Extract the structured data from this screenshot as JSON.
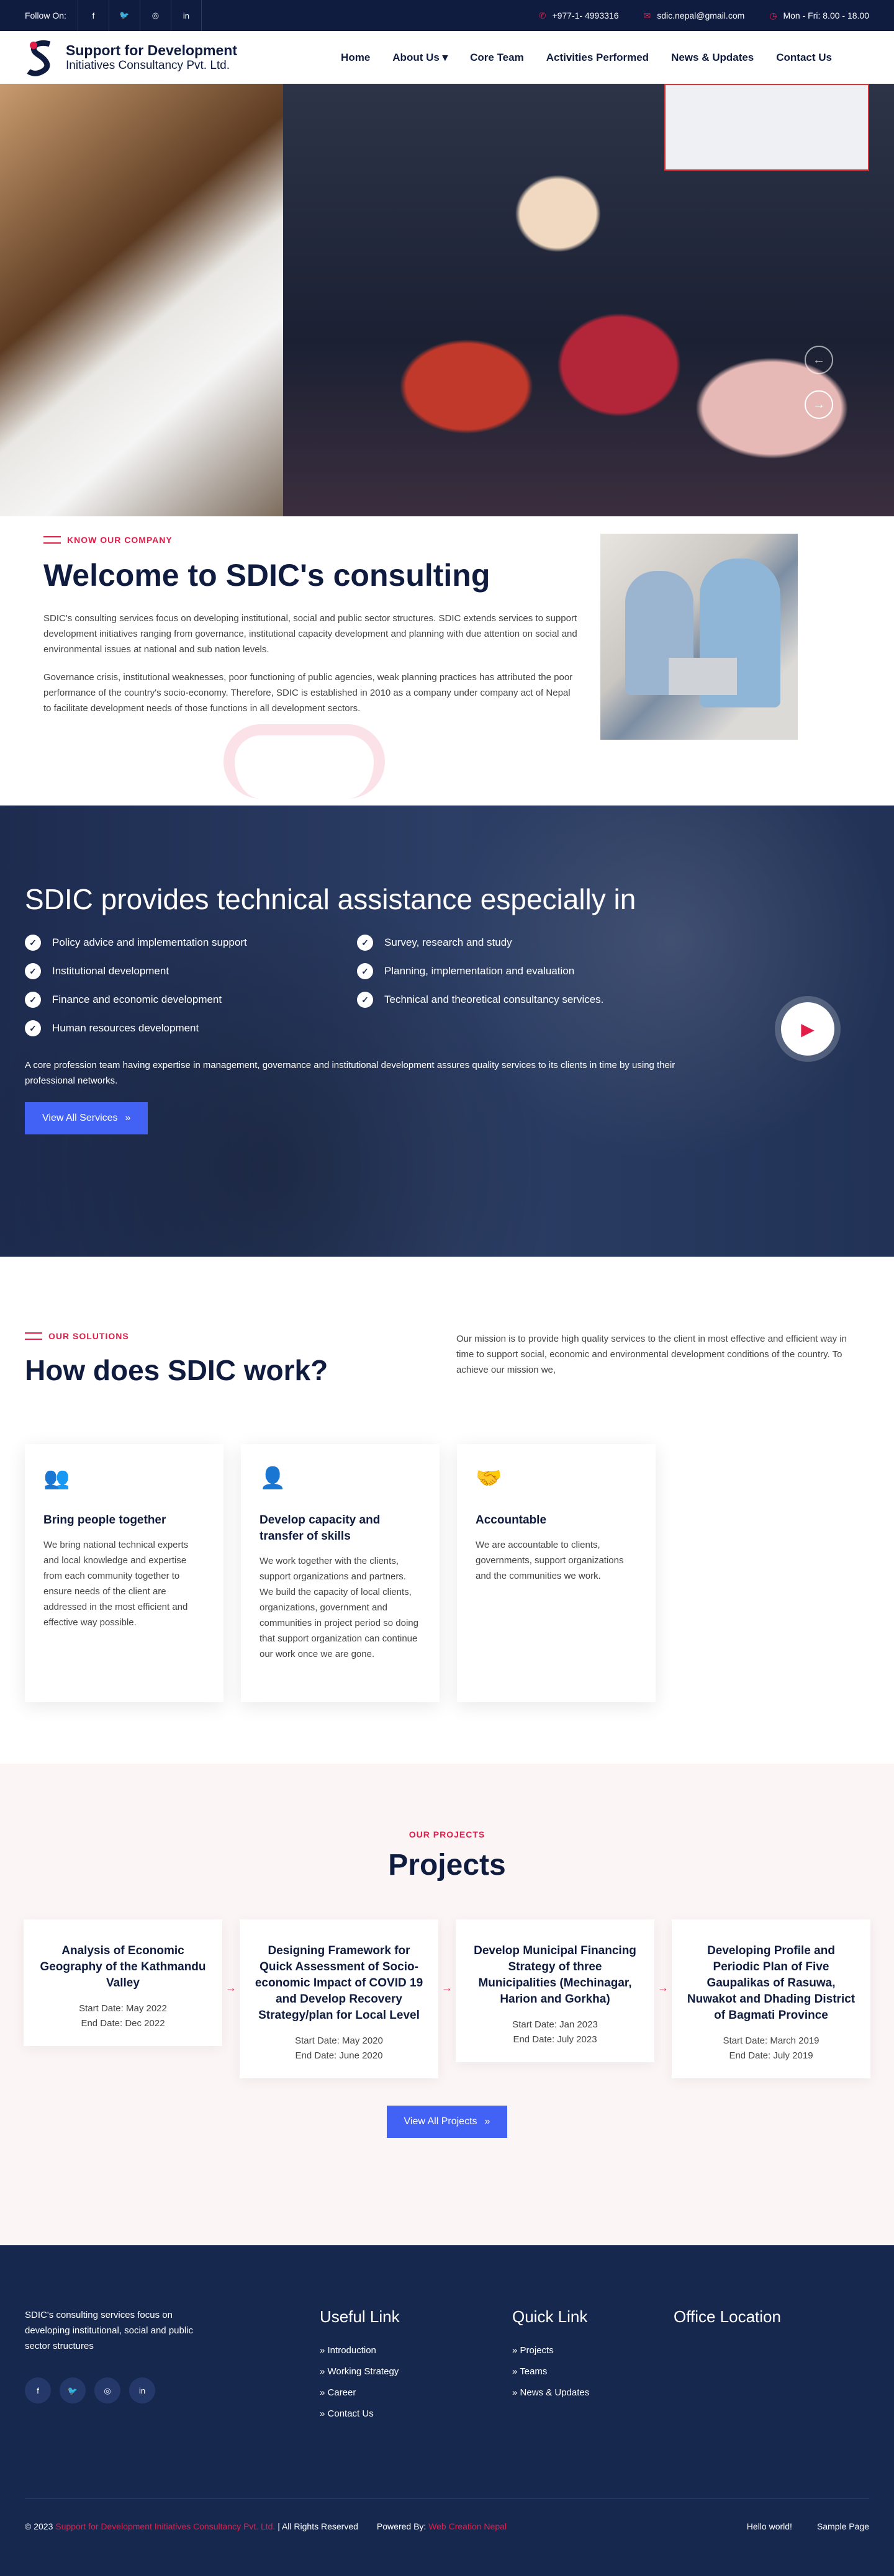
{
  "topbar": {
    "follow": "Follow On:",
    "social_icons": [
      "facebook-icon",
      "twitter-icon",
      "instagram-icon",
      "linkedin-icon"
    ],
    "phone": "+977-1- 4993316",
    "email": "sdic.nepal@gmail.com",
    "hours": "Mon - Fri: 8.00 - 18.00"
  },
  "header": {
    "logo_line1": "Support for Development",
    "logo_line2": "Initiatives Consultancy Pvt. Ltd.",
    "nav": [
      "Home",
      "About Us",
      "Core Team",
      "Activities Performed",
      "News & Updates",
      "Contact Us"
    ]
  },
  "welcome": {
    "kicker": "KNOW OUR COMPANY",
    "title": "Welcome to SDIC's consulting",
    "p1": "SDIC's consulting services focus on developing institutional, social and public sector structures. SDIC extends services to support development initiatives ranging from governance, institutional capacity development and planning with due attention on social and environmental issues at national and sub nation levels.",
    "p2": "Governance crisis, institutional weaknesses, poor functioning of public agencies, weak planning practices has attributed the poor performance of the country's socio-economy. Therefore, SDIC is established in 2010 as a company under company act of Nepal to facilitate development needs of those functions in all development sectors."
  },
  "tech": {
    "title": "SDIC provides technical assistance especially in",
    "items": [
      "Policy advice and implementation support",
      "Survey, research and study",
      "Institutional development",
      "Planning, implementation and evaluation",
      "Finance and economic development",
      "Technical and theoretical consultancy services.",
      "Human resources development"
    ],
    "desc": "A core profession team having expertise in management, governance and institutional development assures quality services to its clients in time by using their professional networks.",
    "button": "View All Services"
  },
  "solutions": {
    "kicker": "OUR SOLUTIONS",
    "title": "How does SDIC work?",
    "mission": "Our mission is to provide high quality services to the client in most effective and efficient way in time to support social, economic and environmental development conditions of the country. To achieve our mission we,",
    "cards": [
      {
        "title": "Bring people together",
        "text": "We bring national technical experts and local knowledge and expertise from each community together to ensure needs of the client are addressed in the most efficient and effective way possible."
      },
      {
        "title": "Develop capacity and transfer of skills",
        "text": "We work together with the clients, support organizations and partners. We build the capacity of local clients, organizations, government and communities in project period so doing that support organization can continue our work once we are gone."
      },
      {
        "title": "Accountable",
        "text": "We are accountable to clients, governments, support organizations and the communities we work."
      }
    ]
  },
  "projects": {
    "kicker": "OUR PROJECTS",
    "title": "Projects",
    "items": [
      {
        "title": "Analysis of Economic Geography of the Kathmandu Valley",
        "start": "Start Date: May 2022",
        "end": "End Date: Dec 2022"
      },
      {
        "title": "Designing Framework for Quick Assessment of Socio-economic Impact of COVID 19 and Develop Recovery Strategy/plan for Local Level",
        "start": "Start Date: May 2020",
        "end": "End Date: June 2020"
      },
      {
        "title": "Develop Municipal Financing Strategy of three Municipalities (Mechinagar, Harion and Gorkha)",
        "start": "Start Date: Jan 2023",
        "end": "End Date: July 2023"
      },
      {
        "title": "Developing Profile and Periodic Plan of Five Gaupalikas of Rasuwa, Nuwakot and Dhading District of Bagmati Province",
        "start": "Start Date: March 2019",
        "end": "End Date: July 2019"
      }
    ],
    "button": "View All Projects"
  },
  "footer": {
    "about": "SDIC's consulting services focus on developing institutional, social and public sector structures",
    "useful_title": "Useful Link",
    "useful": [
      "Introduction",
      "Working Strategy",
      "Career",
      "Contact Us"
    ],
    "quick_title": "Quick Link",
    "quick": [
      "Projects",
      "Teams",
      "News & Updates"
    ],
    "office_title": "Office Location",
    "copy_prefix": "© 2023",
    "copy_company": "Support for Development Initiatives Consultancy Pvt. Ltd.",
    "copy_rights": "| All Rights Reserved",
    "powered_label": "Powered By:",
    "powered_by": "Web Creation Nepal",
    "bottom_links": [
      "Hello world!",
      "Sample Page"
    ]
  }
}
